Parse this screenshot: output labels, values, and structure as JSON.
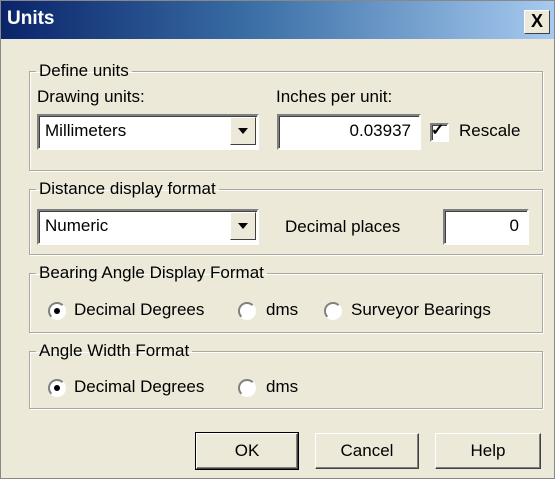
{
  "window": {
    "title": "Units",
    "close_label": "X"
  },
  "define_units": {
    "legend": "Define units",
    "drawing_units_label": "Drawing units:",
    "drawing_units_value": "Millimeters",
    "inches_per_unit_label": "Inches per unit:",
    "inches_per_unit_value": "0.03937",
    "rescale_label": "Rescale",
    "rescale_checked": true
  },
  "distance_format": {
    "legend": "Distance display format",
    "format_value": "Numeric",
    "decimal_places_label": "Decimal places",
    "decimal_places_value": "0"
  },
  "bearing_format": {
    "legend": "Bearing Angle Display Format",
    "options": [
      "Decimal Degrees",
      "dms",
      "Surveyor Bearings"
    ],
    "selected": "Decimal Degrees"
  },
  "angle_width_format": {
    "legend": "Angle Width Format",
    "options": [
      "Decimal Degrees",
      "dms"
    ],
    "selected": "Decimal Degrees"
  },
  "buttons": {
    "ok": "OK",
    "cancel": "Cancel",
    "help": "Help"
  }
}
